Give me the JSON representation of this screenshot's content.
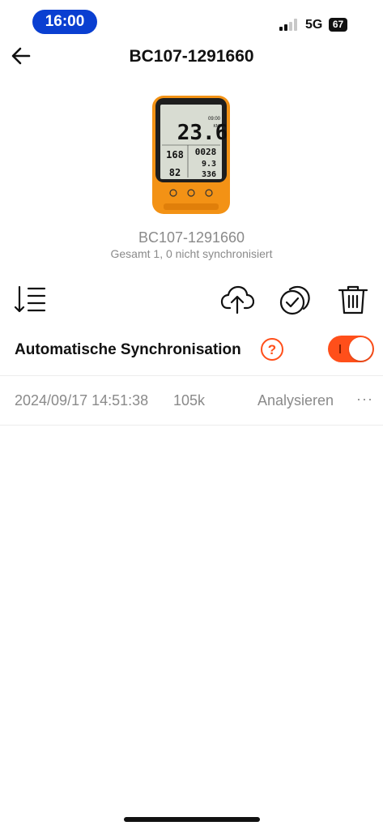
{
  "status_bar": {
    "time": "16:00",
    "network": "5G",
    "battery": "67"
  },
  "header": {
    "title": "BC107-1291660"
  },
  "device": {
    "name": "BC107-1291660",
    "summary": "Gesamt 1, 0 nicht synchronisiert",
    "screen": {
      "speed": "23.6",
      "unit": "KMH",
      "time": "09:00",
      "hr": "168",
      "duration": "0028",
      "distance": "9.3",
      "cadence": "82",
      "altitude": "336"
    }
  },
  "toolbar": {
    "icons": [
      "sort-icon",
      "upload-cloud-icon",
      "sync-check-icon",
      "trash-icon"
    ]
  },
  "auto_sync": {
    "label": "Automatische Synchronisation",
    "enabled": true,
    "help_symbol": "?"
  },
  "records": [
    {
      "date": "2024/09/17 14:51:38",
      "size": "105k",
      "action": "Analysieren",
      "more": "···"
    }
  ],
  "colors": {
    "accent": "#ff4f1a",
    "time_pill": "#0a3fd1",
    "muted_text": "#8a8a8a"
  }
}
